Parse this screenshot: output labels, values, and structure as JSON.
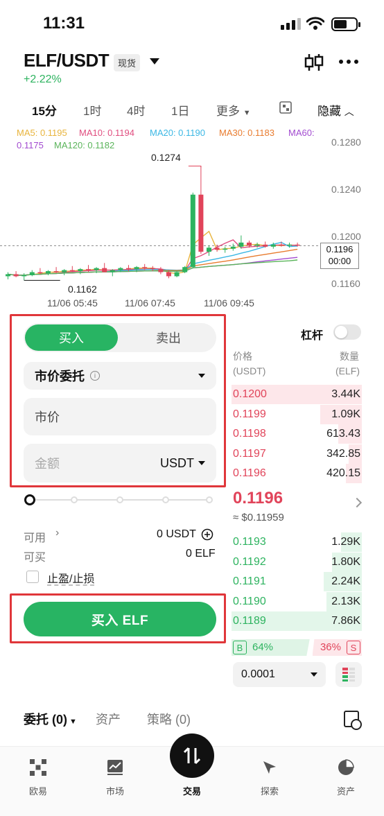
{
  "status": {
    "time": "11:31"
  },
  "header": {
    "pair": "ELF/USDT",
    "market_badge": "现货",
    "change": "+2.22%"
  },
  "timeframes": [
    "15分",
    "1时",
    "4时",
    "1日",
    "更多",
    "隐藏"
  ],
  "chart_data": {
    "type": "candlestick",
    "ma_legend": [
      {
        "label": "MA5: 0.1195",
        "color": "#e8b43c"
      },
      {
        "label": "MA10: 0.1194",
        "color": "#e04d7f"
      },
      {
        "label": "MA20: 0.1190",
        "color": "#3bb7e4"
      },
      {
        "label": "MA30: 0.1183",
        "color": "#e87b2e"
      },
      {
        "label": "MA60:",
        "color": "#a24bd0"
      },
      {
        "label": "0.1175",
        "color": "#a24bd0"
      },
      {
        "label": "MA120: 0.1182",
        "color": "#5ab45a"
      }
    ],
    "y_ticks": [
      "0.1280",
      "0.1240",
      "0.1200",
      "0.1160"
    ],
    "x_ticks": [
      "11/06 05:45",
      "11/06 07:45",
      "11/06 09:45"
    ],
    "high_label": "0.1274",
    "low_label": "0.1162",
    "current_price_tag": "0.1196",
    "current_time_tag": "00:00",
    "candles": [
      {
        "o": 0.1166,
        "h": 0.117,
        "l": 0.1163,
        "c": 0.1168
      },
      {
        "o": 0.1168,
        "h": 0.1171,
        "l": 0.1165,
        "c": 0.1166
      },
      {
        "o": 0.1166,
        "h": 0.1169,
        "l": 0.1162,
        "c": 0.1167
      },
      {
        "o": 0.1167,
        "h": 0.1172,
        "l": 0.1166,
        "c": 0.117
      },
      {
        "o": 0.117,
        "h": 0.1174,
        "l": 0.1168,
        "c": 0.1169
      },
      {
        "o": 0.1169,
        "h": 0.1172,
        "l": 0.1167,
        "c": 0.1171
      },
      {
        "o": 0.1171,
        "h": 0.1175,
        "l": 0.1169,
        "c": 0.117
      },
      {
        "o": 0.117,
        "h": 0.1173,
        "l": 0.1167,
        "c": 0.1172
      },
      {
        "o": 0.1172,
        "h": 0.1176,
        "l": 0.117,
        "c": 0.1171
      },
      {
        "o": 0.1171,
        "h": 0.1174,
        "l": 0.1168,
        "c": 0.1173
      },
      {
        "o": 0.1173,
        "h": 0.1177,
        "l": 0.117,
        "c": 0.1172
      },
      {
        "o": 0.1172,
        "h": 0.1175,
        "l": 0.1169,
        "c": 0.1174
      },
      {
        "o": 0.1174,
        "h": 0.1179,
        "l": 0.1171,
        "c": 0.117
      },
      {
        "o": 0.117,
        "h": 0.1173,
        "l": 0.1166,
        "c": 0.1172
      },
      {
        "o": 0.1172,
        "h": 0.1175,
        "l": 0.117,
        "c": 0.1174
      },
      {
        "o": 0.1174,
        "h": 0.1177,
        "l": 0.1171,
        "c": 0.1173
      },
      {
        "o": 0.1173,
        "h": 0.1176,
        "l": 0.117,
        "c": 0.1175
      },
      {
        "o": 0.1175,
        "h": 0.1178,
        "l": 0.1172,
        "c": 0.1174
      },
      {
        "o": 0.1174,
        "h": 0.1176,
        "l": 0.1171,
        "c": 0.1173
      },
      {
        "o": 0.1173,
        "h": 0.1175,
        "l": 0.1168,
        "c": 0.117
      },
      {
        "o": 0.117,
        "h": 0.1172,
        "l": 0.1164,
        "c": 0.1166
      },
      {
        "o": 0.1166,
        "h": 0.1171,
        "l": 0.1165,
        "c": 0.117
      },
      {
        "o": 0.117,
        "h": 0.1176,
        "l": 0.1169,
        "c": 0.1175
      },
      {
        "o": 0.1175,
        "h": 0.1248,
        "l": 0.1174,
        "c": 0.1246
      },
      {
        "o": 0.1246,
        "h": 0.1274,
        "l": 0.1188,
        "c": 0.119
      },
      {
        "o": 0.119,
        "h": 0.1196,
        "l": 0.1186,
        "c": 0.1194
      },
      {
        "o": 0.1194,
        "h": 0.1197,
        "l": 0.119,
        "c": 0.1192
      },
      {
        "o": 0.1192,
        "h": 0.1195,
        "l": 0.1189,
        "c": 0.1193
      },
      {
        "o": 0.1193,
        "h": 0.1198,
        "l": 0.1191,
        "c": 0.1195
      },
      {
        "o": 0.1195,
        "h": 0.1206,
        "l": 0.1193,
        "c": 0.1199
      },
      {
        "o": 0.1199,
        "h": 0.1201,
        "l": 0.1194,
        "c": 0.1196
      },
      {
        "o": 0.1196,
        "h": 0.1199,
        "l": 0.1194,
        "c": 0.1197
      },
      {
        "o": 0.1197,
        "h": 0.12,
        "l": 0.1194,
        "c": 0.1195
      },
      {
        "o": 0.1195,
        "h": 0.1199,
        "l": 0.1193,
        "c": 0.1197
      },
      {
        "o": 0.1197,
        "h": 0.12,
        "l": 0.1195,
        "c": 0.1196
      },
      {
        "o": 0.1196,
        "h": 0.1199,
        "l": 0.1194,
        "c": 0.1197
      },
      {
        "o": 0.1197,
        "h": 0.1199,
        "l": 0.1195,
        "c": 0.1196
      }
    ],
    "ylim": [
      0.115,
      0.129
    ]
  },
  "order": {
    "buy_tab": "买入",
    "sell_tab": "卖出",
    "order_type": "市价委托",
    "price_placeholder": "市价",
    "amount_placeholder": "金额",
    "amount_currency": "USDT",
    "available_label": "可用",
    "available_value": "0 USDT",
    "can_buy_label": "可买",
    "can_buy_value": "0 ELF",
    "tpsl_label": "止盈/止损",
    "submit": "买入 ELF",
    "slider_percent": 0
  },
  "orderbook": {
    "leverage_label": "杠杆",
    "price_header": "价格",
    "price_unit": "(USDT)",
    "qty_header": "数量",
    "qty_unit": "(ELF)",
    "asks": [
      {
        "price": "0.1200",
        "qty": "3.44K",
        "depth": 1.0
      },
      {
        "price": "0.1199",
        "qty": "1.09K",
        "depth": 0.32
      },
      {
        "price": "0.1198",
        "qty": "613.43",
        "depth": 0.18
      },
      {
        "price": "0.1197",
        "qty": "342.85",
        "depth": 0.1
      },
      {
        "price": "0.1196",
        "qty": "420.15",
        "depth": 0.12
      }
    ],
    "last_price": "0.1196",
    "last_usd": "≈ $0.11959",
    "bids": [
      {
        "price": "0.1193",
        "qty": "1.29K",
        "depth": 0.16
      },
      {
        "price": "0.1192",
        "qty": "1.80K",
        "depth": 0.23
      },
      {
        "price": "0.1191",
        "qty": "2.24K",
        "depth": 0.29
      },
      {
        "price": "0.1190",
        "qty": "2.13K",
        "depth": 0.27
      },
      {
        "price": "0.1189",
        "qty": "7.86K",
        "depth": 1.0
      }
    ],
    "buy_label": "B",
    "buy_ratio": "64%",
    "sell_ratio": "36%",
    "sell_label": "S",
    "precision": "0.0001"
  },
  "bottom_tabs": {
    "orders": "委托 (0)",
    "assets": "资产",
    "strategy": "策略 (0)"
  },
  "nav": [
    {
      "label": "欧易",
      "icon": "okx-logo-icon"
    },
    {
      "label": "市场",
      "icon": "market-chart-icon"
    },
    {
      "label": "交易",
      "icon": "trade-arrows-icon"
    },
    {
      "label": "探索",
      "icon": "explore-compass-icon"
    },
    {
      "label": "资产",
      "icon": "assets-pie-icon"
    }
  ]
}
